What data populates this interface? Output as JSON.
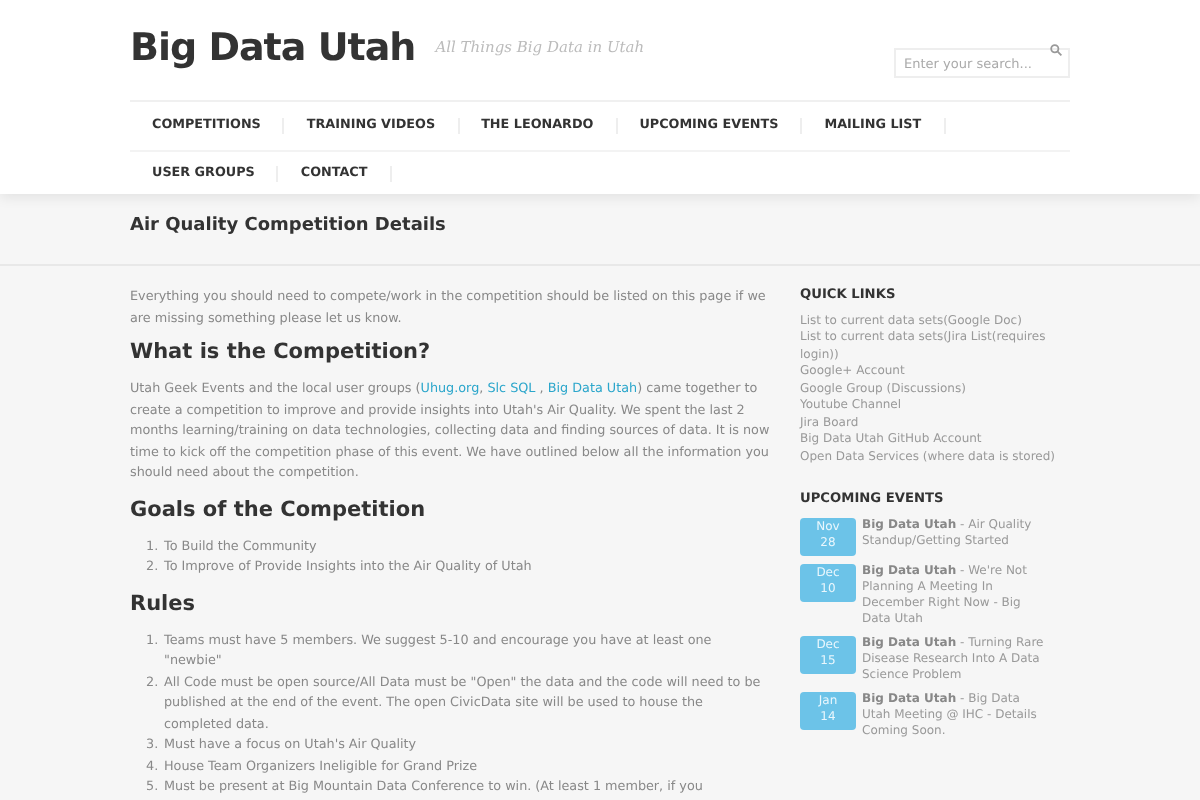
{
  "site": {
    "title": "Big Data Utah",
    "tagline": "All Things Big Data in Utah"
  },
  "search": {
    "placeholder": "Enter your search..."
  },
  "nav": {
    "rows": [
      [
        "COMPETITIONS",
        "TRAINING VIDEOS",
        "THE LEONARDO",
        "UPCOMING EVENTS",
        "MAILING LIST"
      ],
      [
        "USER GROUPS",
        "CONTACT"
      ]
    ]
  },
  "page_title": "Air Quality Competition Details",
  "content": [
    {
      "kind": "paragraph",
      "text": "Everything you should need to compete/work in the competition should be listed on this page if we are missing something please let us know."
    },
    {
      "kind": "heading",
      "text": "What is the Competition?"
    },
    {
      "kind": "rich",
      "parts": [
        {
          "text": "Utah Geek Events and the local user groups (",
          "link": false
        },
        {
          "text": "Uhug.org",
          "link": true
        },
        {
          "text": ", ",
          "link": false
        },
        {
          "text": "Slc SQL ",
          "link": true
        },
        {
          "text": ", ",
          "link": false
        },
        {
          "text": "Big Data Utah",
          "link": true
        },
        {
          "text": ") came together to create a competition to improve and provide insights into Utah's Air Quality. We spent the last 2 months learning/training on data technologies, collecting data and finding sources of data. It is now time to kick off the competition phase of this event. We have outlined below all the information you should need about the competition.",
          "link": false
        }
      ]
    },
    {
      "kind": "heading",
      "text": "Goals of the Competition"
    },
    {
      "kind": "list",
      "items": [
        {
          "number": "1.",
          "text": "To Build the Community"
        },
        {
          "number": "2.",
          "text": "To Improve of Provide Insights into the Air Quality of Utah"
        }
      ]
    },
    {
      "kind": "heading",
      "text": "Rules"
    },
    {
      "kind": "list",
      "items": [
        {
          "number": "1.",
          "text": "Teams must have 5 members. We suggest 5-10 and encourage you have at least one \"newbie\""
        },
        {
          "number": "2.",
          "text": "All Code must be open source/All Data must be \"Open\" the data and the code will need to be published at the end of the event. The open CivicData site will be used to house the completed data."
        },
        {
          "number": "3.",
          "text": "Must have a focus on Utah's Air Quality"
        },
        {
          "number": "4.",
          "text": "House Team Organizers Ineligible for Grand Prize"
        },
        {
          "number": "5.",
          "text": "Must be present at Big Mountain Data Conference to win. (At least 1 member, if you"
        }
      ]
    }
  ],
  "quick_links": {
    "title": "QUICK LINKS",
    "links": [
      "List to current data sets(Google Doc)",
      "List to current data sets(Jira List(requires login))",
      "Google+ Account",
      "Google Group (Discussions)",
      "Youtube Channel",
      "Jira Board",
      "Big Data Utah GitHub Account",
      "Open Data Services (where data is stored)"
    ]
  },
  "upcoming_events": {
    "title": "UPCOMING EVENTS",
    "events": [
      {
        "month": "Nov",
        "day": "28",
        "group": "Big Data Utah",
        "title": " - Air Quality Standup/Getting Started"
      },
      {
        "month": "Dec",
        "day": "10",
        "group": "Big Data Utah",
        "title": " - We're Not Planning A Meeting In December Right Now - Big Data Utah"
      },
      {
        "month": "Dec",
        "day": "15",
        "group": "Big Data Utah",
        "title": " - Turning Rare Disease Research Into A Data Science Problem"
      },
      {
        "month": "Jan",
        "day": "14",
        "group": "Big Data Utah",
        "title": " - Big Data Utah Meeting @ IHC - Details Coming Soon."
      }
    ]
  }
}
